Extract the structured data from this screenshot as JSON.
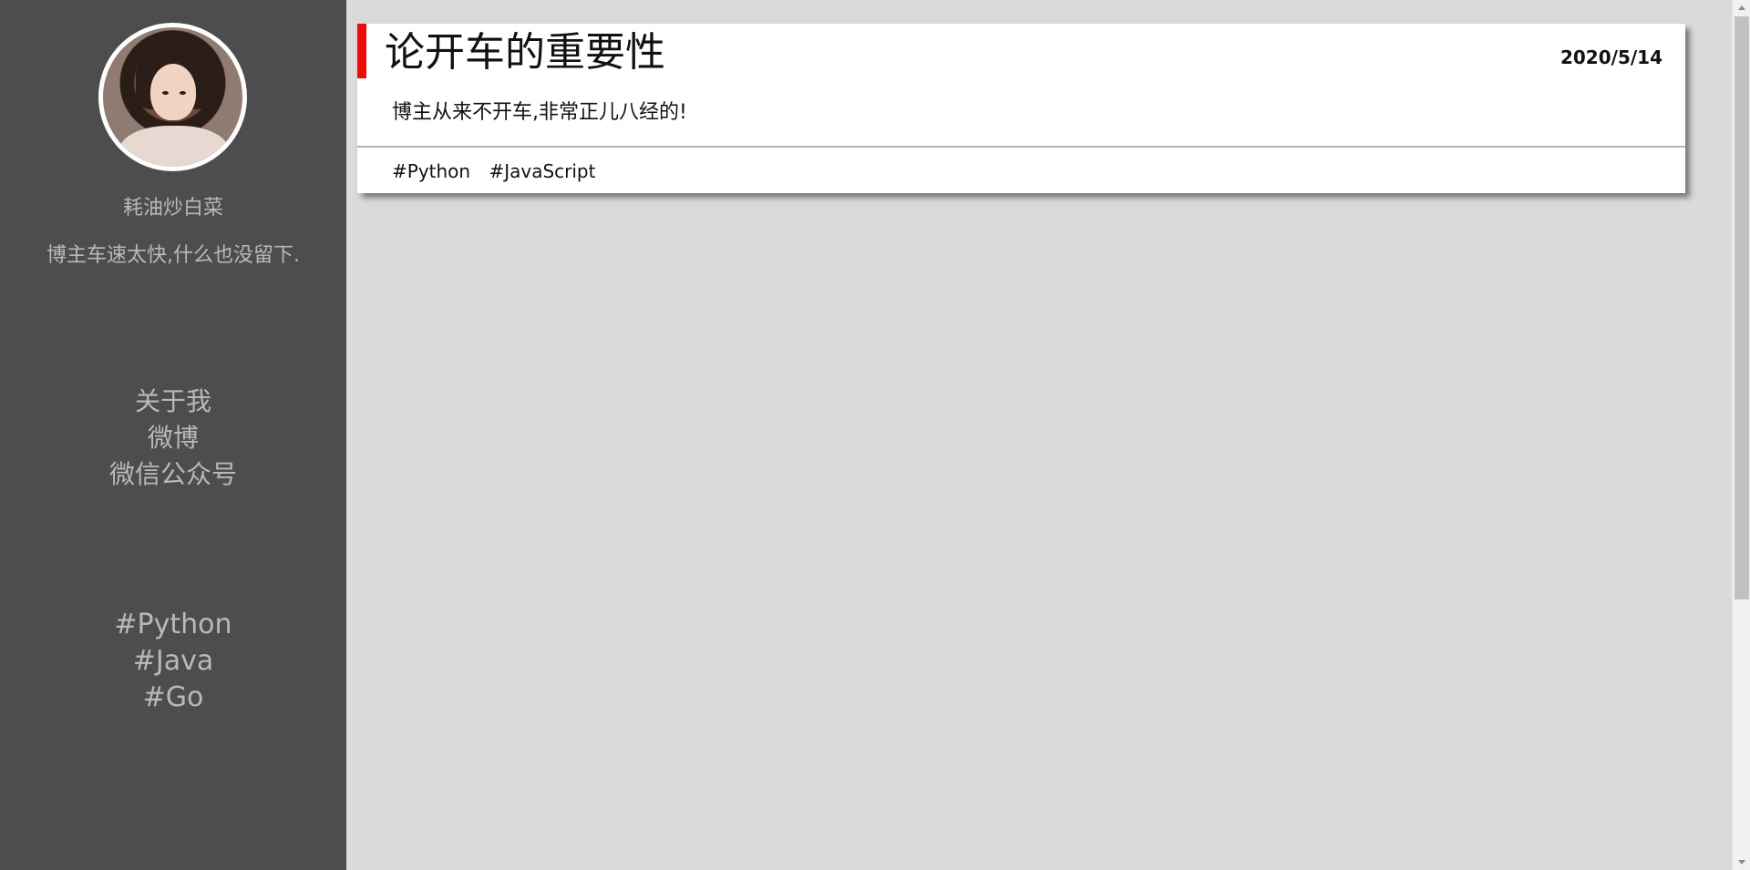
{
  "sidebar": {
    "username": "耗油炒白菜",
    "bio": "博主车速太快,什么也没留下.",
    "nav": [
      "关于我",
      "微博",
      "微信公众号"
    ],
    "tags": [
      "#Python",
      "#Java",
      "#Go"
    ]
  },
  "post": {
    "title": "论开车的重要性",
    "date": "2020/5/14",
    "excerpt": "博主从来不开车,非常正儿八经的!",
    "tags": [
      "#Python",
      "#JavaScript"
    ]
  },
  "colors": {
    "sidebar_bg": "#4d4d4d",
    "page_bg": "#dcd9da",
    "accent": "#f00a0a"
  }
}
